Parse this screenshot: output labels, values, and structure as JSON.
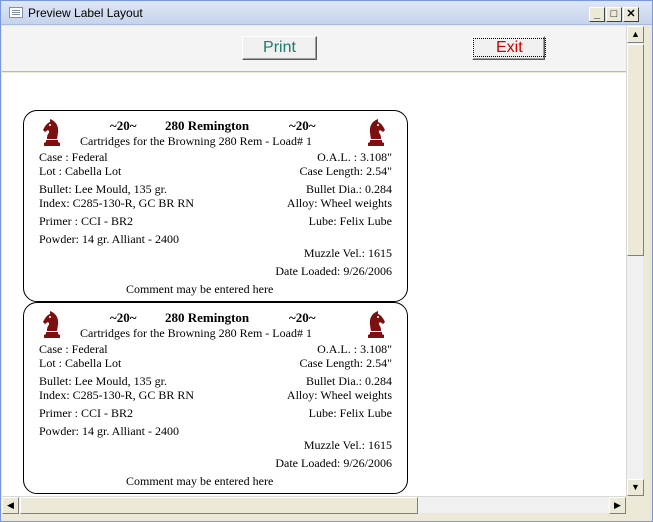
{
  "window": {
    "title": "Preview Label Layout"
  },
  "toolbar": {
    "print_label": "Print",
    "exit_label": "Exit"
  },
  "labels": [
    {
      "count_left": "~20~",
      "cartridge": "280 Remington",
      "count_right": "~20~",
      "subtitle": "Cartridges for the Browning 280 Rem - Load# 1",
      "case": "Case   : Federal",
      "oal": "O.A.L. :  3.108\"",
      "lot": "Lot    : Cabella Lot",
      "case_length": "Case Length:  2.54\"",
      "bullet": "Bullet: Lee Mould, 135 gr.",
      "bullet_dia": "Bullet Dia.:  0.284",
      "index": "Index: C285-130-R, GC BR RN",
      "alloy": "Alloy:  Wheel weights",
      "primer": "Primer : CCI - BR2",
      "lube": "Lube:  Felix Lube",
      "powder": "Powder: 14 gr.  Alliant - 2400",
      "muzzle": "Muzzle Vel.:  1615",
      "date": "Date Loaded:  9/26/2006",
      "comment": "Comment may be entered here"
    },
    {
      "count_left": "~20~",
      "cartridge": "280 Remington",
      "count_right": "~20~",
      "subtitle": "Cartridges for the Browning 280 Rem - Load# 1",
      "case": "Case   : Federal",
      "oal": "O.A.L. :  3.108\"",
      "lot": "Lot    : Cabella Lot",
      "case_length": "Case Length:  2.54\"",
      "bullet": "Bullet: Lee Mould, 135 gr.",
      "bullet_dia": "Bullet Dia.:  0.284",
      "index": "Index: C285-130-R, GC BR RN",
      "alloy": "Alloy:  Wheel weights",
      "primer": "Primer : CCI - BR2",
      "lube": "Lube:  Felix Lube",
      "powder": "Powder: 14 gr.  Alliant - 2400",
      "muzzle": "Muzzle Vel.:  1615",
      "date": "Date Loaded:  9/26/2006",
      "comment": "Comment may be entered here"
    }
  ],
  "icons": {
    "logo": "knight-chess-piece-icon"
  },
  "colors": {
    "print_text": "#1a7a6e",
    "exit_text": "#d00000",
    "knight": "#7a1010"
  }
}
